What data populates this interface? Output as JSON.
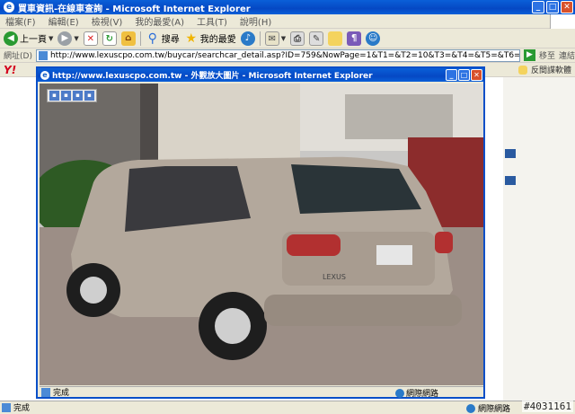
{
  "window": {
    "title": "買車資訊-在線車查詢 - Microsoft Internet Explorer",
    "buttons": {
      "minimize": "_",
      "maximize": "□",
      "close": "✕"
    }
  },
  "menu": {
    "items": [
      "檔案(F)",
      "編輯(E)",
      "檢視(V)",
      "我的最愛(A)",
      "工具(T)",
      "說明(H)"
    ]
  },
  "toolbar": {
    "back_label": "上一頁",
    "search_label": "搜尋",
    "favorites_label": "我的最愛"
  },
  "address": {
    "label": "網址(D)",
    "url": "http://www.lexuscpo.com.tw/buycar/searchcar_detail.asp?ID=759&NowPage=1&T1=&T2=10&T3=&T4=&T5=&T6=",
    "go_label": "移至",
    "links_label": "連結"
  },
  "linksbar": {
    "yahoo": "Y!",
    "right_text": "反間諜軟體"
  },
  "popup": {
    "title": "http://www.lexuscpo.com.tw - 外觀放大圖片 - Microsoft Internet Explorer",
    "status": "完成",
    "zone": "網際網路"
  },
  "status": {
    "text": "完成",
    "zone": "網際網路"
  },
  "watermark": "#4031161",
  "photo": {
    "plate_text": "LEXUS",
    "colors": {
      "car": "#b3a89c",
      "sky": "#c9c8c6",
      "pavement": "#9c8e86",
      "building": "#d9d3c8"
    }
  }
}
